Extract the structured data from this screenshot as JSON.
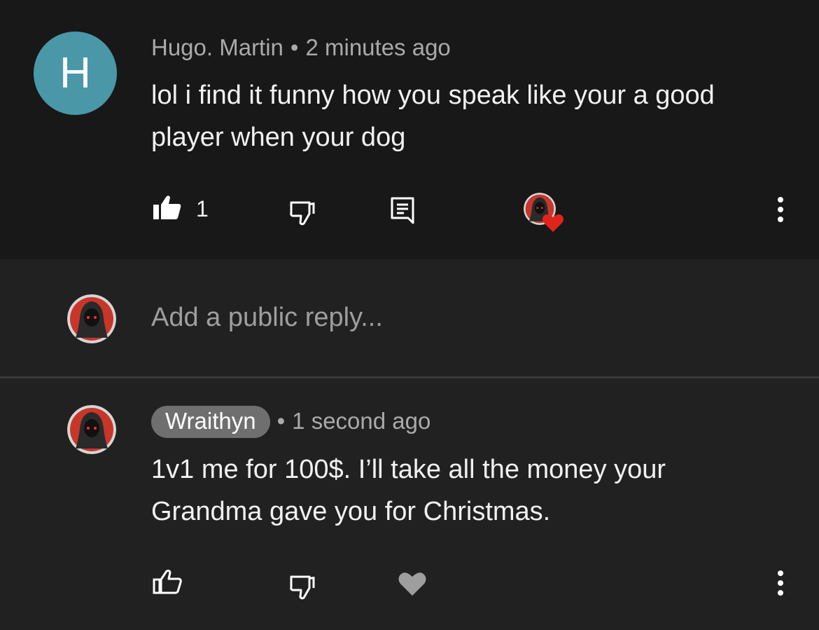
{
  "comment": {
    "avatar_letter": "H",
    "author": "Hugo. Martin",
    "separator": "•",
    "time": "2 minutes ago",
    "text_line1": "lol i find it funny how you speak like your a good",
    "text_line2": "player when your dog",
    "likes": "1"
  },
  "reply_input": {
    "placeholder": "Add a public reply..."
  },
  "reply": {
    "author": "Wraithyn",
    "separator": "•",
    "time": "1 second ago",
    "text_line1": "1v1 me for 100$. I’ll take all the money your",
    "text_line2": "Grandma gave you for Christmas."
  },
  "colors": {
    "avatar_h": "#4a97a8",
    "heart_red": "#e0241c",
    "chip_bg": "#6f6f6f"
  }
}
